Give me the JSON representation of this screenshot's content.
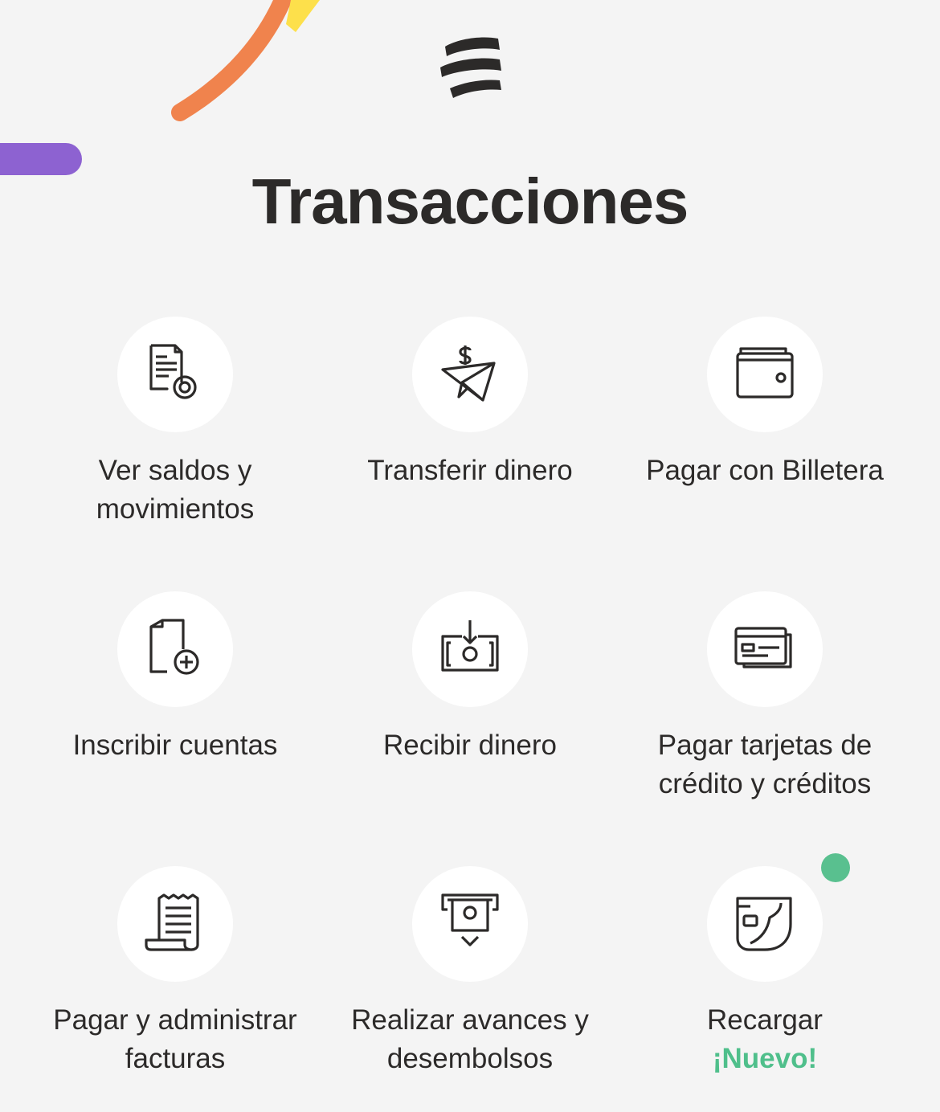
{
  "header": {
    "title": "Transacciones"
  },
  "colors": {
    "background": "#f4f4f4",
    "text": "#2c2a29",
    "new_badge": "#4fbf8b",
    "decor_orange": "#f0834d",
    "decor_yellow": "#fde04b",
    "decor_purple": "#8d62d1"
  },
  "tiles": [
    {
      "icon": "document-balance-icon",
      "line1": "Ver saldos y",
      "line2": "movimientos"
    },
    {
      "icon": "money-paper-plane-icon",
      "line1": "Transferir dinero",
      "line2": ""
    },
    {
      "icon": "wallet-icon",
      "line1": "Pagar con Billetera",
      "line2": ""
    },
    {
      "icon": "document-add-icon",
      "line1": "Inscribir cuentas",
      "line2": ""
    },
    {
      "icon": "receive-money-icon",
      "line1": "Recibir dinero",
      "line2": ""
    },
    {
      "icon": "credit-cards-icon",
      "line1": "Pagar tarjetas de",
      "line2": "crédito y créditos"
    },
    {
      "icon": "bill-receipt-icon",
      "line1": "Pagar y administrar",
      "line2": "facturas"
    },
    {
      "icon": "atm-withdraw-icon",
      "line1": "Realizar avances y",
      "line2": "desembolsos"
    },
    {
      "icon": "phone-recharge-icon",
      "line1": "Recargar",
      "line2": "¡Nuevo!"
    }
  ]
}
